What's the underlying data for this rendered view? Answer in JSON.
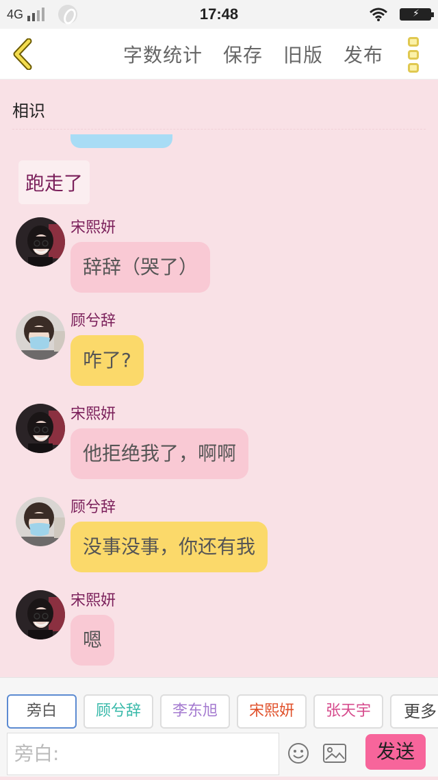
{
  "status_bar": {
    "network": "4G",
    "time": "17:48"
  },
  "nav": {
    "actions": [
      "字数统计",
      "保存",
      "旧版",
      "发布"
    ]
  },
  "chat": {
    "title": "相识",
    "narration": "跑走了",
    "messages": [
      {
        "sender": "宋熙妍",
        "text": "辞辞（哭了）",
        "color": "pink",
        "avatar": "girl-glasses-avatar"
      },
      {
        "sender": "顾兮辞",
        "text": "咋了?",
        "color": "yellow",
        "avatar": "girl-mask-avatar"
      },
      {
        "sender": "宋熙妍",
        "text": "他拒绝我了，啊啊",
        "color": "pink",
        "avatar": "girl-glasses-avatar"
      },
      {
        "sender": "顾兮辞",
        "text": "没事没事，你还有我",
        "color": "yellow",
        "avatar": "girl-mask-avatar"
      },
      {
        "sender": "宋熙妍",
        "text": "嗯",
        "color": "pink",
        "avatar": "girl-glasses-avatar"
      }
    ]
  },
  "roles": [
    {
      "label": "旁白",
      "color": "#555555",
      "active": true
    },
    {
      "label": "顾兮辞",
      "color": "#35b8a8",
      "active": false
    },
    {
      "label": "李东旭",
      "color": "#a57bd0",
      "active": false
    },
    {
      "label": "宋熙妍",
      "color": "#e0502a",
      "active": false
    },
    {
      "label": "张天宇",
      "color": "#d64a8c",
      "active": false
    }
  ],
  "roles_more_label": "更多",
  "input": {
    "placeholder": "旁白:"
  },
  "send_label": "发送",
  "colors": {
    "background": "#f9e1e6",
    "pink_bubble": "#f9c9d4",
    "yellow_bubble": "#fbd96a",
    "send_button": "#f7659b",
    "name_color": "#7a1f5a"
  }
}
